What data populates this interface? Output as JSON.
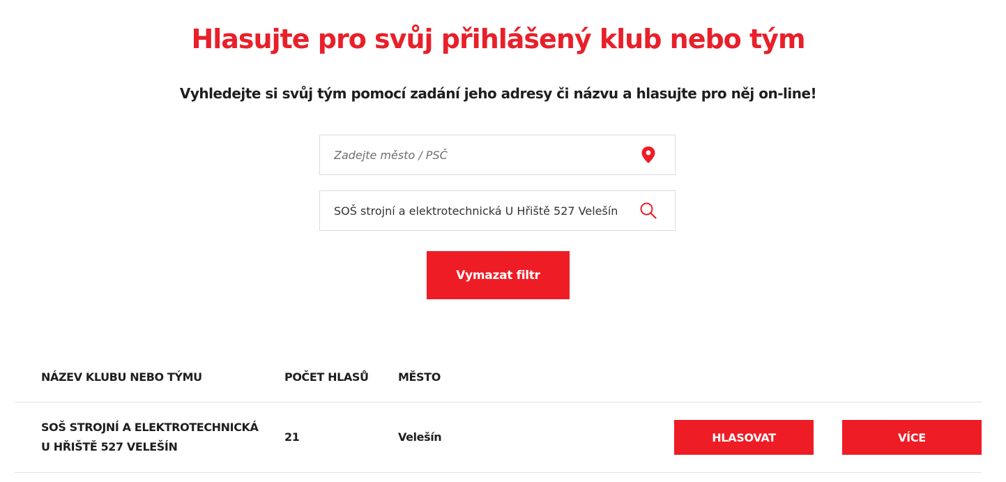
{
  "header": {
    "title": "Hlasujte pro svůj přihlášený klub nebo tým",
    "subtitle": "Vyhledejte si svůj tým pomocí zadání jeho adresy či názvu a hlasujte pro něj on-line!"
  },
  "search": {
    "city_placeholder": "Zadejte město / PSČ",
    "city_value": "",
    "city_icon": "map-pin-icon",
    "name_value": "SOŠ strojní a elektrotechnická U Hřiště 527 Velešín",
    "name_icon": "search-icon",
    "clear_label": "Vymazat filtr"
  },
  "table": {
    "columns": [
      "NÁZEV KLUBU NEBO TÝMU",
      "POČET HLASŮ",
      "MĚSTO"
    ],
    "rows": [
      {
        "name": "SOŠ STROJNÍ A ELEKTROTECHNICKÁ U HŘIŠTĚ 527 VELEŠÍN",
        "votes": "21",
        "city": "Velešín",
        "vote_label": "HLASOVAT",
        "more_label": "VÍCE"
      }
    ]
  },
  "colors": {
    "accent": "#ee1c25",
    "title": "#e8202a",
    "text": "#1e1e1e"
  }
}
